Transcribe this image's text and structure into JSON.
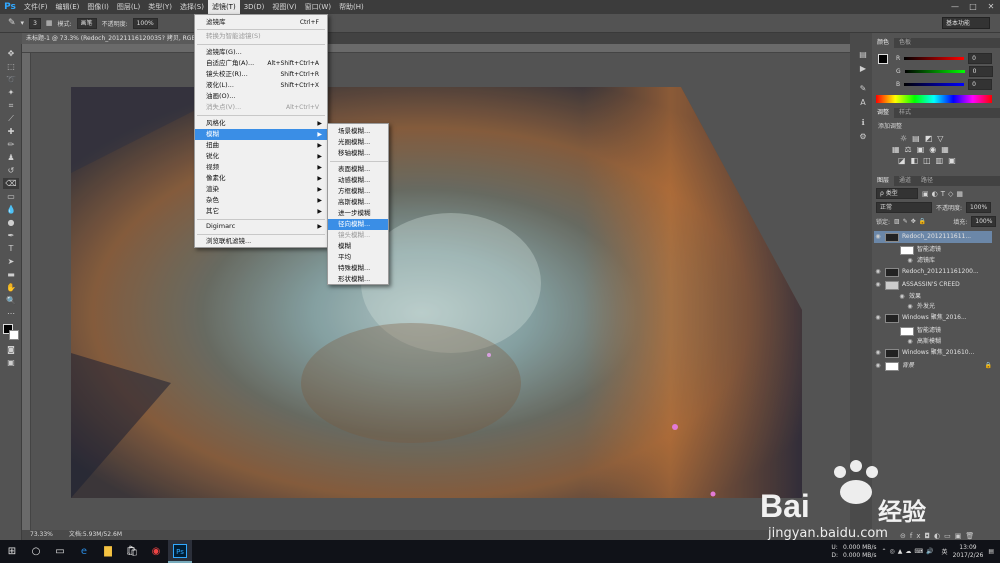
{
  "app": {
    "logo": "Ps"
  },
  "menubar": {
    "items": [
      "文件(F)",
      "编辑(E)",
      "图像(I)",
      "图层(L)",
      "类型(Y)",
      "选择(S)",
      "滤镜(T)",
      "3D(D)",
      "视图(V)",
      "窗口(W)",
      "帮助(H)"
    ],
    "active_index": 6
  },
  "window_controls": {
    "min": "—",
    "max": "□",
    "close": "✕"
  },
  "options_bar": {
    "brush_size": "3",
    "mode_label": "模式:",
    "mode_value": "画笔",
    "opacity_label": "不透明度:",
    "opacity_value": "100%",
    "workspace": "基本功能"
  },
  "document_tab": {
    "title": "未标题-1 @ 73.3% (Redoch_20121116120035? 拷贝, RGB/8) *"
  },
  "status": {
    "zoom": "73.33%",
    "doc_size": "文档:5.93M/52.6M"
  },
  "filter_menu": [
    {
      "label": "滤镜库",
      "shortcut": "Ctrl+F",
      "disabled": false
    },
    {
      "label": "转换为智能滤镜(S)",
      "shortcut": "",
      "disabled": true
    },
    {
      "label": "滤镜库(G)...",
      "shortcut": "",
      "disabled": false
    },
    {
      "label": "自适应广角(A)...",
      "shortcut": "Alt+Shift+Ctrl+A",
      "disabled": false
    },
    {
      "label": "镜头校正(R)...",
      "shortcut": "Shift+Ctrl+R",
      "disabled": false
    },
    {
      "label": "液化(L)...",
      "shortcut": "Shift+Ctrl+X",
      "disabled": false
    },
    {
      "label": "油画(O)...",
      "shortcut": "",
      "disabled": false
    },
    {
      "label": "消失点(V)...",
      "shortcut": "Alt+Ctrl+V",
      "disabled": true
    },
    {
      "label": "风格化",
      "submenu": true
    },
    {
      "label": "模糊",
      "submenu": true,
      "highlighted": true
    },
    {
      "label": "扭曲",
      "submenu": true
    },
    {
      "label": "锐化",
      "submenu": true
    },
    {
      "label": "视频",
      "submenu": true
    },
    {
      "label": "像素化",
      "submenu": true
    },
    {
      "label": "渲染",
      "submenu": true
    },
    {
      "label": "杂色",
      "submenu": true
    },
    {
      "label": "其它",
      "submenu": true
    },
    {
      "label": "Digimarc",
      "submenu": true
    },
    {
      "label": "浏览联机滤镜...",
      "shortcut": ""
    }
  ],
  "blur_menu": [
    {
      "label": "场景模糊..."
    },
    {
      "label": "光圈模糊..."
    },
    {
      "label": "移轴模糊..."
    },
    {
      "label": "表面模糊..."
    },
    {
      "label": "动感模糊..."
    },
    {
      "label": "方框模糊..."
    },
    {
      "label": "高斯模糊..."
    },
    {
      "label": "进一步模糊"
    },
    {
      "label": "径向模糊...",
      "highlighted": true
    },
    {
      "label": "镜头模糊...",
      "disabled": true
    },
    {
      "label": "模糊"
    },
    {
      "label": "平均"
    },
    {
      "label": "特殊模糊..."
    },
    {
      "label": "形状模糊..."
    }
  ],
  "color_panel": {
    "tabs": [
      "颜色",
      "色板"
    ],
    "r": "0",
    "g": "0",
    "b": "0"
  },
  "adjust_panel": {
    "tabs": [
      "调整",
      "样式"
    ],
    "title": "添加调整"
  },
  "layers_panel": {
    "tabs": [
      "图层",
      "通道",
      "路径"
    ],
    "kind": "ρ 类型",
    "blend": "正常",
    "opacity_label": "不透明度:",
    "opacity": "100%",
    "lock_label": "锁定:",
    "fill_label": "填充:",
    "fill": "100%",
    "layers": [
      {
        "name": "Redoch_2012111611...",
        "selected": true
      },
      {
        "name": "智能滤镜"
      },
      {
        "name": "滤镜库"
      },
      {
        "name": "Redoch_201211161200..."
      },
      {
        "name": "ASSASSIN'S CREED"
      },
      {
        "name": "效果"
      },
      {
        "name": "外发光"
      },
      {
        "name": "Windows 聚焦_2016..."
      },
      {
        "name": "智能滤镜"
      },
      {
        "name": "高斯模糊"
      },
      {
        "name": "Windows 聚焦_201610..."
      },
      {
        "name": "背景"
      }
    ]
  },
  "taskbar": {
    "time": "13:09",
    "date": "2017/2/26",
    "net_up": "0.000 MB/s",
    "net_down": "0.000 MB/s",
    "u_label": "U:",
    "d_label": "D:",
    "ime": "英"
  },
  "watermark": {
    "brand": "Bai",
    "brand2": "经验",
    "url": "jingyan.baidu.com"
  }
}
